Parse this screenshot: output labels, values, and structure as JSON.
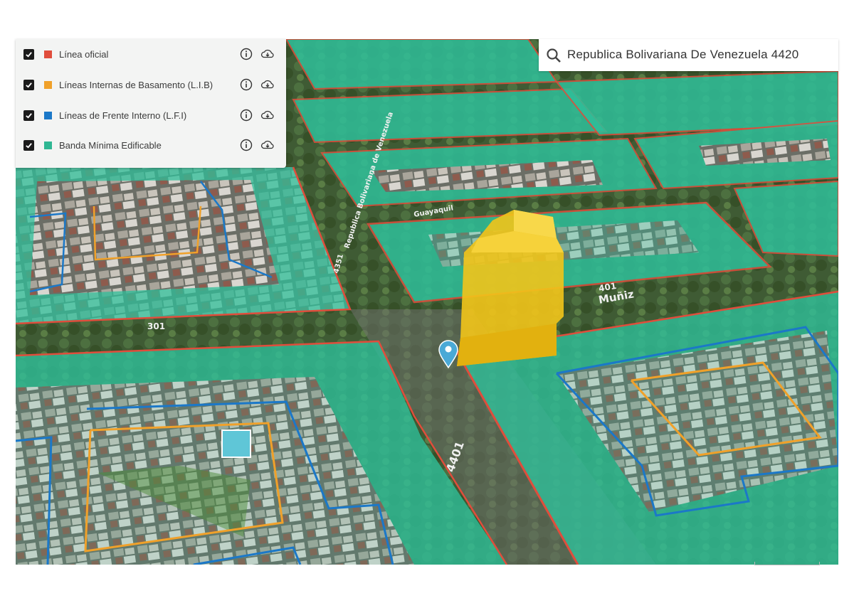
{
  "legend": {
    "items": [
      {
        "label": "Línea oficial",
        "color": "#e04d3c",
        "checked": true
      },
      {
        "label": "Líneas Internas de Basamento (L.I.B)",
        "color": "#f0a12a",
        "checked": true
      },
      {
        "label": "Líneas de Frente Interno (L.F.I)",
        "color": "#1b78c8",
        "checked": true
      },
      {
        "label": "Banda Mínima Edificable",
        "color": "#2fb793",
        "checked": true
      }
    ],
    "info_icon": "info-icon",
    "download_icon": "cloud-download-icon"
  },
  "search": {
    "icon": "search-icon",
    "value": "Republica Bolivariana De Venezuela 4420"
  },
  "map": {
    "street_labels": [
      "401",
      "Muñiz",
      "301",
      "4401",
      "4351",
      "Republica Bolivariana de Venezuela",
      "Guayaquil"
    ],
    "marker_icon": "location-pin-icon",
    "building_color": "#f2c41a",
    "band_color": "#2fbf9a",
    "official_line_color": "#e04d3c",
    "lib_color": "#f0a12a",
    "lfi_color": "#1b78c8"
  }
}
